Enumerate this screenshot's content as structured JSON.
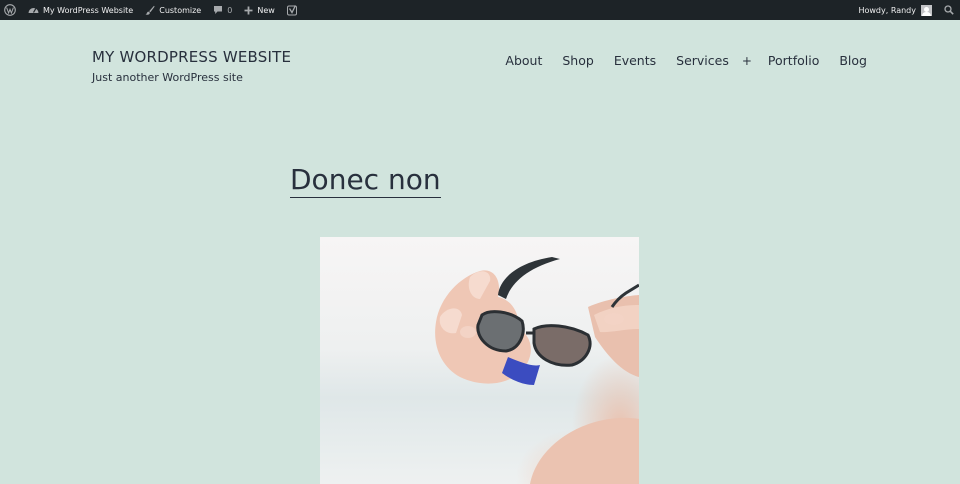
{
  "admin_bar": {
    "site_name": "My WordPress Website",
    "customize_label": "Customize",
    "comments_count": "0",
    "new_label": "New",
    "greeting": "Howdy, Randy",
    "icons": [
      "wordpress-logo-icon",
      "dashboard-icon",
      "brush-icon",
      "comment-icon",
      "plus-icon",
      "yoast-icon",
      "user-avatar",
      "search-icon"
    ]
  },
  "site": {
    "title": "MY WORDPRESS WEBSITE",
    "description": "Just another WordPress site"
  },
  "nav": {
    "items": [
      "About",
      "Shop",
      "Events",
      "Services",
      "Portfolio",
      "Blog"
    ],
    "submenu_toggle": "+"
  },
  "post": {
    "title": "Donec non",
    "featured_image": "hands holding sunglasses"
  },
  "colors": {
    "page_background": "#d1e4dd",
    "admin_bar_background": "#1d2327",
    "text": "#28303d"
  }
}
